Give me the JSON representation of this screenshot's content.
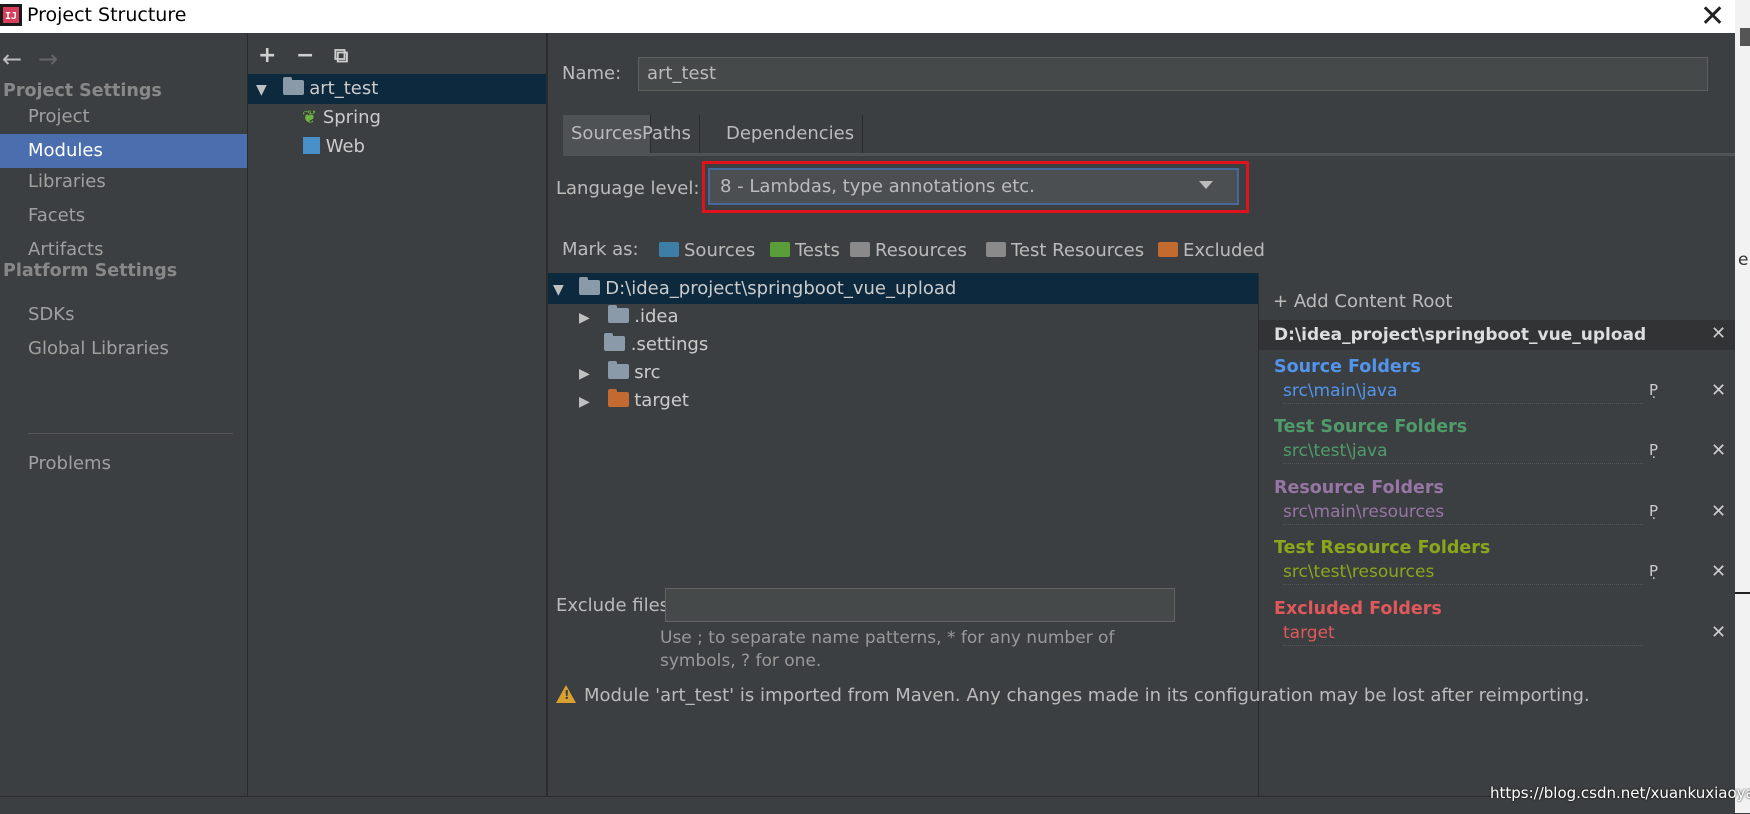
{
  "window": {
    "title": "Project Structure"
  },
  "nav": {
    "back": "←",
    "forward": "→",
    "project_settings": "Project Settings",
    "platform_settings": "Platform Settings",
    "items": [
      {
        "label": "Project"
      },
      {
        "label": "Modules"
      },
      {
        "label": "Libraries"
      },
      {
        "label": "Facets"
      },
      {
        "label": "Artifacts"
      },
      {
        "label": "SDKs"
      },
      {
        "label": "Global Libraries"
      },
      {
        "label": "Problems"
      }
    ]
  },
  "module_tree": {
    "add": "+",
    "remove": "−",
    "copy": "⧉",
    "root": "art_test",
    "children": [
      "Spring",
      "Web"
    ]
  },
  "content": {
    "name_label": "Name:",
    "name_value": "art_test",
    "tabs": [
      "Sources",
      "Paths",
      "Dependencies"
    ],
    "language_label": "Language level:",
    "language_value": "8 - Lambdas, type annotations etc.",
    "mark_as_label": "Mark as:",
    "mark_as": [
      {
        "label": "Sources",
        "color": "#3d7ea6"
      },
      {
        "label": "Tests",
        "color": "#5a9e3a"
      },
      {
        "label": "Resources",
        "color": "#8a8a8a"
      },
      {
        "label": "Test Resources",
        "color": "#8a8a8a"
      },
      {
        "label": "Excluded",
        "color": "#c26a30"
      }
    ],
    "folder_tree": {
      "root": "D:\\idea_project\\springboot_vue_upload",
      "children": [
        ".idea",
        ".settings",
        "src",
        "target"
      ]
    },
    "exclude_label": "Exclude files:",
    "exclude_hint": "Use ; to separate name patterns, * for any number of symbols, ? for one.",
    "warning": "Module 'art_test' is imported from Maven. Any changes made in its configuration may be lost after reimporting."
  },
  "roots": {
    "add_label": "Add Content Root",
    "root_path": "D:\\idea_project\\springboot_vue_upload",
    "groups": [
      {
        "title": "Source Folders",
        "path": "src\\main\\java",
        "color": "#5394ec"
      },
      {
        "title": "Test Source Folders",
        "path": "src\\test\\java",
        "color": "#4f9c6a"
      },
      {
        "title": "Resource Folders",
        "path": "src\\main\\resources",
        "color": "#9775a5"
      },
      {
        "title": "Test Resource Folders",
        "path": "src\\test\\resources",
        "color": "#8aa71c"
      },
      {
        "title": "Excluded Folders",
        "path": "target",
        "color": "#e0585a"
      }
    ]
  },
  "watermark": "https://blog.csdn.net/xuankuxiaoyao"
}
